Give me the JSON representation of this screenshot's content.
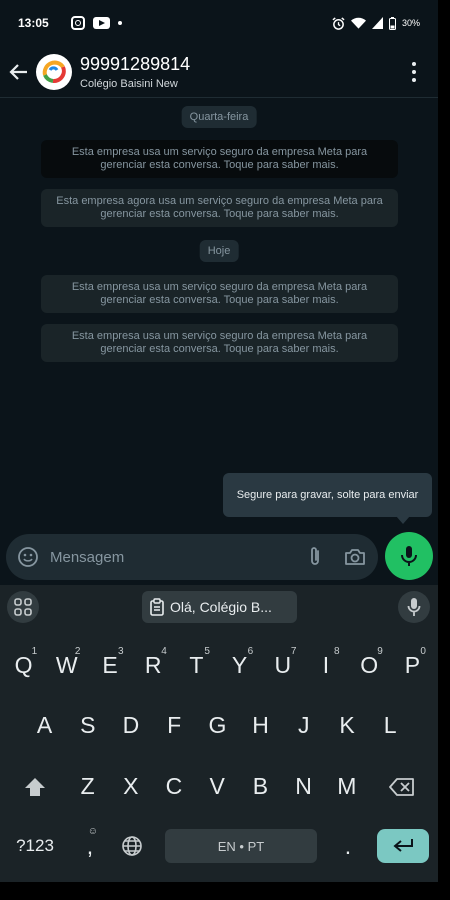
{
  "status_bar": {
    "time": "13:05",
    "battery": "30%"
  },
  "header": {
    "title": "99991289814",
    "subtitle": "Colégio Baisini New"
  },
  "chat": {
    "date_chips": [
      "Quarta-feira",
      "Hoje"
    ],
    "system_messages": [
      "Esta empresa usa um serviço seguro da empresa Meta para gerenciar esta conversa. Toque para saber mais.",
      "Esta empresa agora usa um serviço seguro da empresa Meta para gerenciar esta conversa. Toque para saber mais.",
      "Esta empresa usa um serviço seguro da empresa Meta para gerenciar esta conversa. Toque para saber mais.",
      "Esta empresa usa um serviço seguro da empresa Meta para gerenciar esta conversa. Toque para saber mais."
    ],
    "tooltip": "Segure para gravar, solte para enviar"
  },
  "input": {
    "placeholder": "Mensagem"
  },
  "keyboard": {
    "suggestion": "Olá, Colégio B...",
    "row1": [
      "Q",
      "W",
      "E",
      "R",
      "T",
      "Y",
      "U",
      "I",
      "O",
      "P"
    ],
    "row1_digits": [
      "1",
      "2",
      "3",
      "4",
      "5",
      "6",
      "7",
      "8",
      "9",
      "0"
    ],
    "row2": [
      "A",
      "S",
      "D",
      "F",
      "G",
      "H",
      "J",
      "K",
      "L"
    ],
    "row3": [
      "Z",
      "X",
      "C",
      "V",
      "B",
      "N",
      "M"
    ],
    "symbols_key": "?123",
    "comma_key": ",",
    "comma_sup": "☺",
    "space_label": "EN • PT",
    "period_key": "."
  }
}
